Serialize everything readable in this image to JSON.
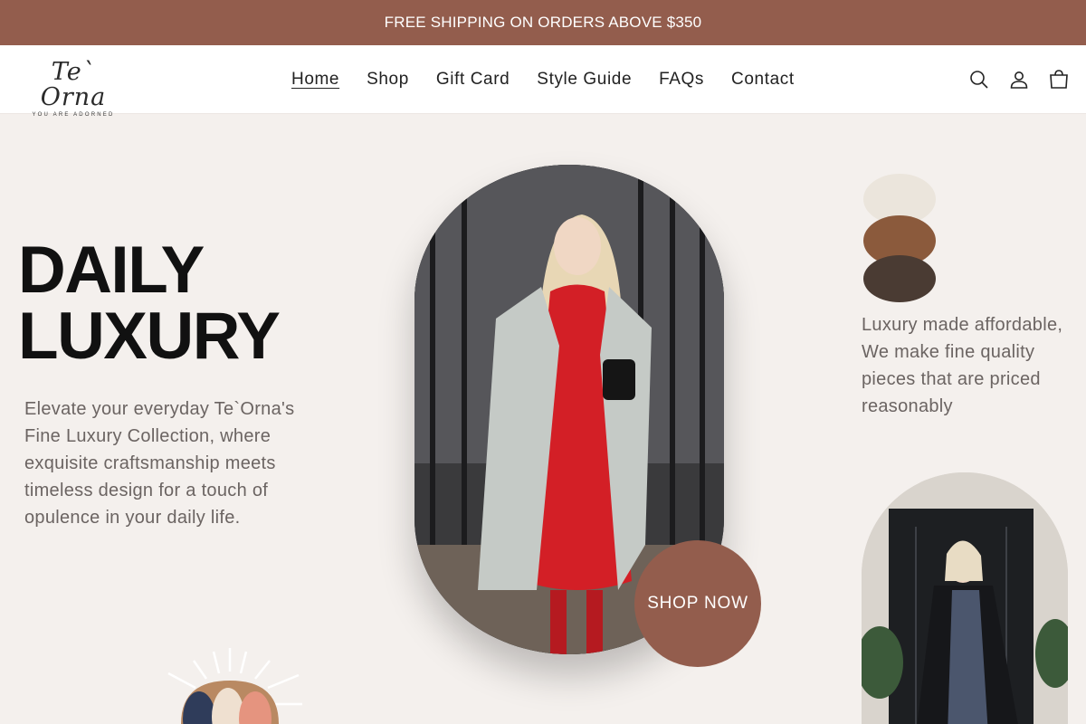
{
  "announcement": {
    "text": "FREE SHIPPING ON ORDERS ABOVE $350"
  },
  "logo": {
    "script": "Te` Orna",
    "tagline": "YOU ARE ADORNED"
  },
  "nav": {
    "items": [
      {
        "label": "Home",
        "active": true
      },
      {
        "label": "Shop",
        "active": false
      },
      {
        "label": "Gift Card",
        "active": false
      },
      {
        "label": "Style Guide",
        "active": false
      },
      {
        "label": "FAQs",
        "active": false
      },
      {
        "label": "Contact",
        "active": false
      }
    ]
  },
  "header_icons": [
    "search-icon",
    "account-icon",
    "cart-icon"
  ],
  "hero": {
    "title_line1": "DAILY",
    "title_line2": "LUXURY",
    "description": "Elevate your everyday Te`Orna's Fine Luxury Collection, where exquisite craftsmanship meets timeless design for a touch of opulence in your daily life.",
    "cta": "SHOP NOW"
  },
  "side": {
    "text": "Luxury made affordable, We make fine quality pieces that are priced reasonably"
  },
  "colors": {
    "accent": "#935d4d",
    "background": "#f4f0ed",
    "text_muted": "#6b6462",
    "heading": "#111111"
  }
}
